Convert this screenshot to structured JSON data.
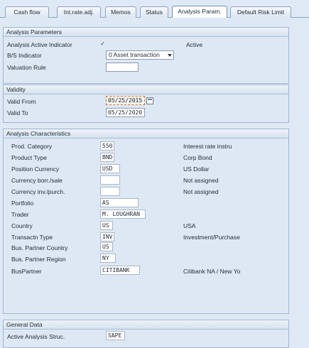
{
  "tabs": [
    {
      "label": "Cash flow"
    },
    {
      "label": "Int.rate.adj."
    },
    {
      "label": "Memos"
    },
    {
      "label": "Status"
    },
    {
      "label": "Analysis Param."
    },
    {
      "label": "Default Risk Limit"
    }
  ],
  "analysis_parameters": {
    "title": "Analysis Parameters",
    "active_indicator_label": "Analysis Active Indicator",
    "active_checked": "✓",
    "active_text": "Active",
    "bs_indicator_label": "B/S Indicator",
    "bs_indicator_value": "0 Asset transaction",
    "valuation_rule_label": "Valuation Rule",
    "valuation_rule_value": ""
  },
  "validity": {
    "title": "Validity",
    "valid_from_label": "Valid From",
    "valid_from_value": "05/25/2015",
    "valid_to_label": "Valid To",
    "valid_to_value": "05/25/2020"
  },
  "analysis_characteristics": {
    "title": "Analysis Characteristics",
    "rows": [
      {
        "label": "Prod. Category",
        "value": "550",
        "desc": "Interest rate instru"
      },
      {
        "label": "Product Type",
        "value": "BND",
        "desc": "Corp Bond"
      },
      {
        "label": "Position Currency",
        "value": "USD",
        "desc": "US Dollar"
      },
      {
        "label": "Currency borr./sale",
        "value": "",
        "desc": "Not assigned"
      },
      {
        "label": "Currency inv./purch.",
        "value": "",
        "desc": "Not assigned"
      },
      {
        "label": "Portfolio",
        "value": "AS",
        "desc": ""
      },
      {
        "label": "Trader",
        "value": "M. LOUGHRAN",
        "desc": ""
      },
      {
        "label": "Country",
        "value": "US",
        "desc": "USA"
      },
      {
        "label": "Transactn Type",
        "value": "INV",
        "desc": "Investment/Purchase"
      },
      {
        "label": "Bus. Partner Country",
        "value": "US",
        "desc": ""
      },
      {
        "label": "Bus. Partner Region",
        "value": "NY",
        "desc": ""
      },
      {
        "label": "BusPartner",
        "value": "CITIBANK",
        "desc": "Citibank NA / New Yo"
      }
    ]
  },
  "general_data": {
    "title": "General Data",
    "active_struc_label": "Active Analysis Struc.",
    "active_struc_value": "SAPE"
  }
}
